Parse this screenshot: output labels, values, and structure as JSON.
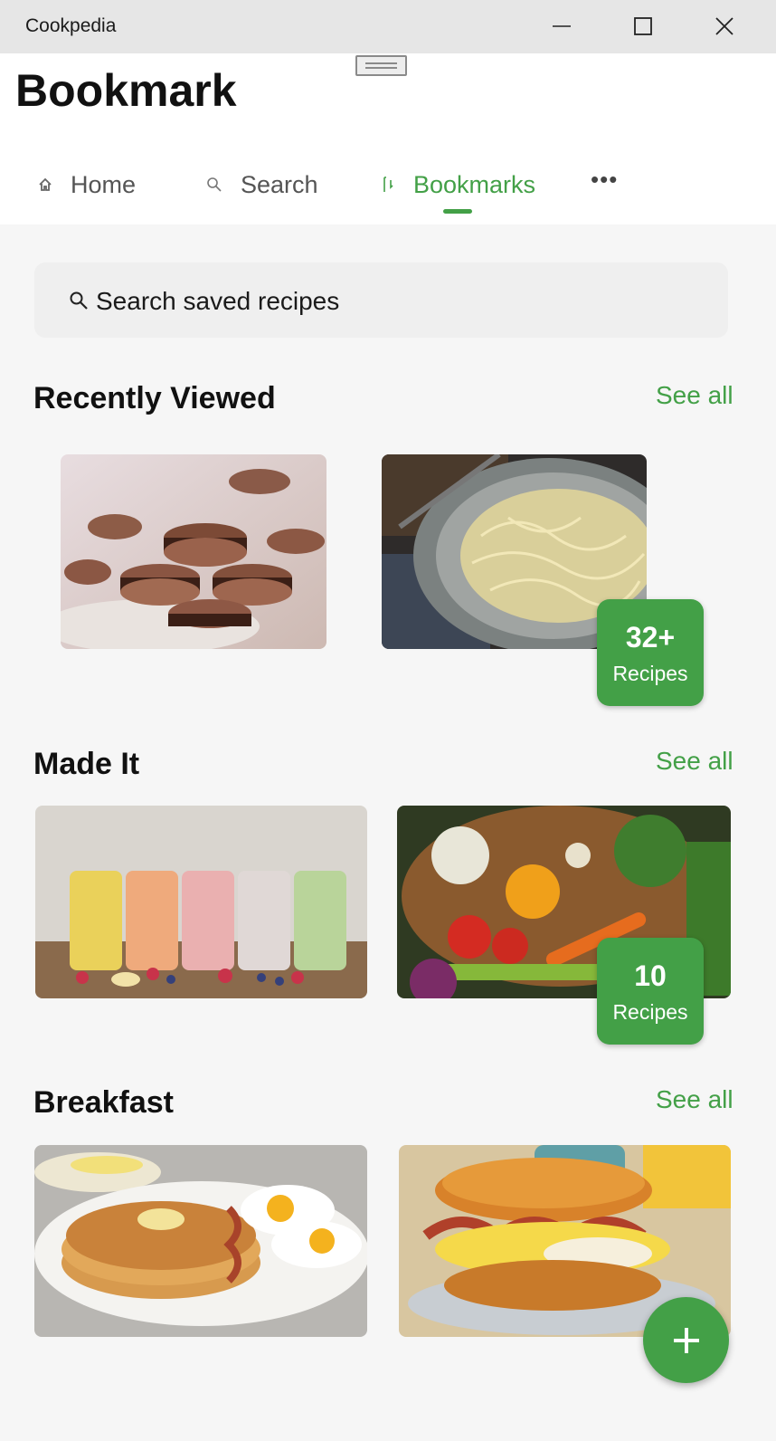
{
  "window": {
    "title": "Cookpedia"
  },
  "header": {
    "title": "Bookmark"
  },
  "nav": {
    "items": [
      {
        "label": "Home",
        "icon": "home-icon"
      },
      {
        "label": "Search",
        "icon": "search-icon"
      },
      {
        "label": "Bookmarks",
        "icon": "bookmark-icon",
        "active": true
      }
    ],
    "more": "•••"
  },
  "search": {
    "placeholder": "Search saved recipes"
  },
  "sections": [
    {
      "title": "Recently Viewed",
      "see_all": "See all",
      "cards": [
        {
          "image": "chocolate macarons"
        },
        {
          "image": "fettuccine alfredo pasta"
        }
      ],
      "badge": {
        "count": "32+",
        "label": "Recipes"
      }
    },
    {
      "title": "Made It",
      "see_all": "See all",
      "cards": [
        {
          "image": "fruit smoothies in jars"
        },
        {
          "image": "basket of fresh vegetables"
        }
      ],
      "badge": {
        "count": "10",
        "label": "Recipes"
      }
    },
    {
      "title": "Breakfast",
      "see_all": "See all",
      "cards": [
        {
          "image": "pancakes with eggs and bacon"
        },
        {
          "image": "hash brown breakfast sandwich"
        }
      ]
    }
  ],
  "colors": {
    "accent": "#43a047",
    "background": "#f6f6f6",
    "titlebar": "#e6e6e6"
  }
}
